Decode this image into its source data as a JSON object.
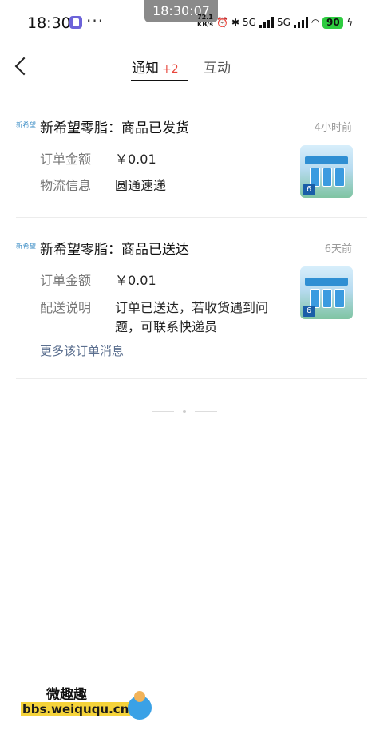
{
  "status_bar": {
    "time": "18:30",
    "more": "···",
    "screen_clock": "18:30:07",
    "net_speed_value": "72.1",
    "net_speed_unit": "KB/s",
    "sim1": "5G",
    "sim2": "5G",
    "battery": "90"
  },
  "header": {
    "tabs": [
      {
        "label": "通知",
        "badge": "+2",
        "active": true
      },
      {
        "label": "互动",
        "active": false
      }
    ]
  },
  "notifications": [
    {
      "brand": "新希望",
      "title": "新希望零脂：商品已发货",
      "time": "4小时前",
      "rows": [
        {
          "label": "订单金额",
          "value": "￥0.01"
        },
        {
          "label": "物流信息",
          "value": "圆通速递"
        }
      ],
      "thumb_price": "6"
    },
    {
      "brand": "新希望",
      "title": "新希望零脂：商品已送达",
      "time": "6天前",
      "rows": [
        {
          "label": "订单金额",
          "value": "￥0.01"
        },
        {
          "label": "配送说明",
          "value_line1": "订单已送达，若收货遇到问",
          "value_line2": "题，可联系快递员"
        }
      ],
      "more_link": "更多该订单消息",
      "thumb_price": "6"
    }
  ],
  "watermark": {
    "line1": "微趣趣",
    "line2": "bbs.weiququ.cn"
  },
  "colors": {
    "badge_red": "#e8463b",
    "link_blue_gray": "#5b6f8f",
    "brand_blue": "#3c8ec6"
  }
}
